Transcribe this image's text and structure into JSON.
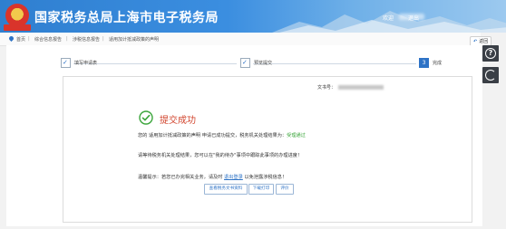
{
  "header": {
    "title": "国家税务总局上海市电子税务局",
    "user_links": [
      "欢迎",
      "退出"
    ]
  },
  "breadcrumb": {
    "items": [
      "首页",
      "综合信息报告",
      "涉税信息报告",
      "适用加计抵减政策的声明"
    ],
    "back_label": "返回"
  },
  "steps": [
    {
      "label": "填写申请表",
      "state": "done"
    },
    {
      "label": "预览提交",
      "state": "done"
    },
    {
      "label": "完成",
      "state": "current",
      "number": "3"
    }
  ],
  "result": {
    "doc_number_label": "文书号：",
    "title": "提交成功",
    "line1_prefix": "您的 适用加计抵减政策的声明 申请已成功提交，税务机关处理结果为：",
    "line1_status": "受理通过",
    "line2": "请等待税务机关处理结果，您可以在\"我的待办\"事项中跟踪此事项的办理进度！",
    "line3_prefix": "温馨提示：若您已办完相关业务，请及时",
    "line3_link": "退出登录",
    "line3_suffix": "以免泄露涉税信息！",
    "buttons": [
      "查看税务文书资料",
      "下载打印",
      "评价"
    ]
  },
  "colors": {
    "header_blue": "#2f7fd0",
    "accent_blue": "#2e73c6",
    "success_green": "#3aa53a",
    "title_red": "#d2452e"
  }
}
